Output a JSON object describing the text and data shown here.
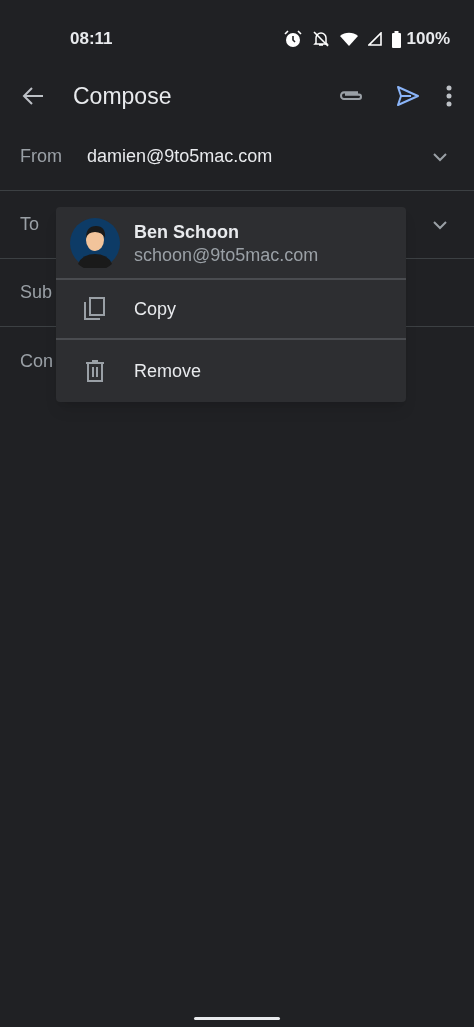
{
  "status_bar": {
    "time": "08:11",
    "battery": "100%"
  },
  "app_bar": {
    "title": "Compose"
  },
  "fields": [
    {
      "label": "From",
      "value": "damien@9to5mac.com",
      "dropdown": true
    },
    {
      "label": "To",
      "dropdown": true
    },
    {
      "label": "Sub",
      "dropdown": false
    },
    {
      "label": "Con",
      "dropdown": false
    }
  ],
  "contact_menu": {
    "name": "Ben Schoon",
    "email": "schoon@9to5mac.com",
    "items": [
      {
        "kind": "copy",
        "label": "Copy"
      },
      {
        "kind": "remove",
        "label": "Remove"
      }
    ]
  }
}
